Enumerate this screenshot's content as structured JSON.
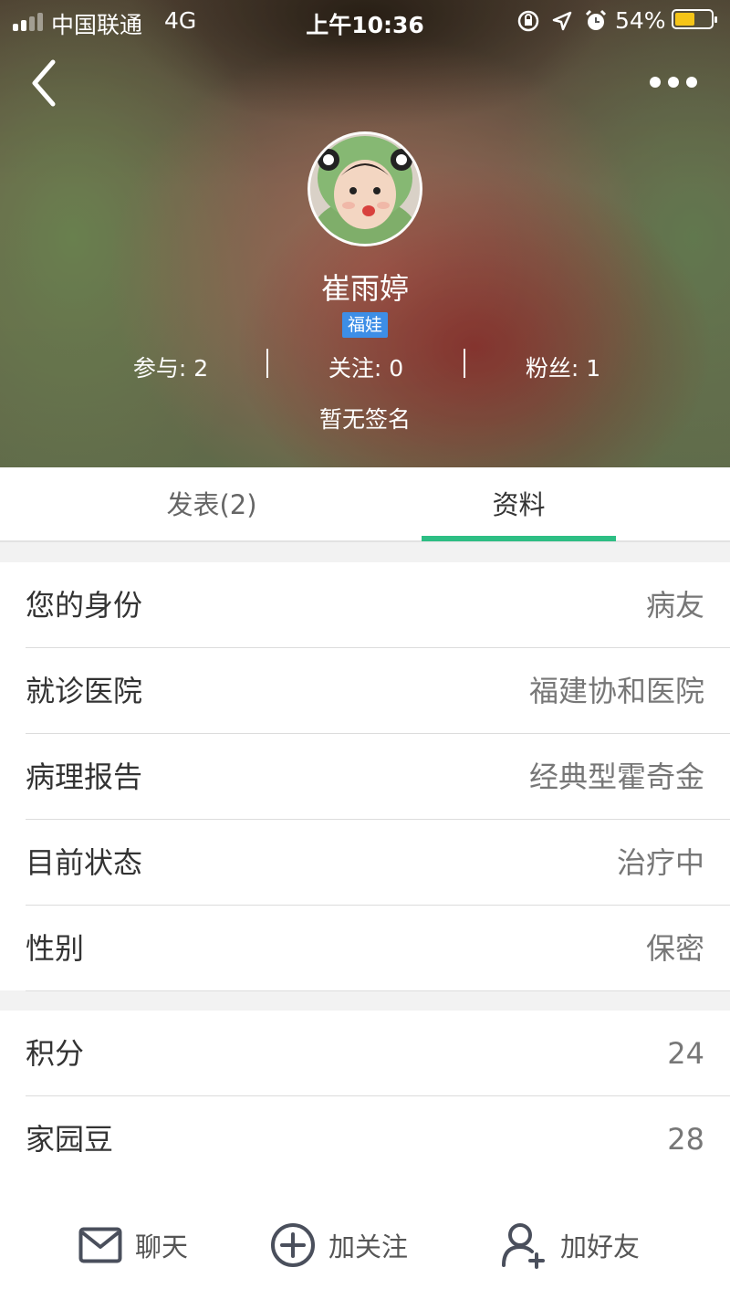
{
  "status_bar": {
    "carrier": "中国联通",
    "network": "4G",
    "time": "上午10:36",
    "battery_percent": "54%",
    "battery_level": 0.54,
    "icons": [
      "orientation-lock-icon",
      "location-icon",
      "alarm-icon"
    ]
  },
  "header": {
    "back_icon": "chevron-left-icon",
    "more_icon": "more-dots-icon"
  },
  "profile": {
    "name": "崔雨婷",
    "badge": "福娃",
    "stats": [
      {
        "label": "参与: 2"
      },
      {
        "label": "关注: 0"
      },
      {
        "label": "粉丝: 1"
      }
    ],
    "signature": "暂无签名"
  },
  "tabs": {
    "posts": "发表(2)",
    "profile": "资料",
    "active": "profile",
    "accent_color": "#2dbe84"
  },
  "details": [
    {
      "label": "您的身份",
      "value": "病友"
    },
    {
      "label": "就诊医院",
      "value": "福建协和医院"
    },
    {
      "label": "病理报告",
      "value": "经典型霍奇金"
    },
    {
      "label": "目前状态",
      "value": "治疗中"
    },
    {
      "label": "性别",
      "value": "保密"
    }
  ],
  "points": [
    {
      "label": "积分",
      "value": "24"
    },
    {
      "label": "家园豆",
      "value": "28"
    }
  ],
  "actions": {
    "chat": "聊天",
    "follow": "加关注",
    "add_friend": "加好友"
  }
}
